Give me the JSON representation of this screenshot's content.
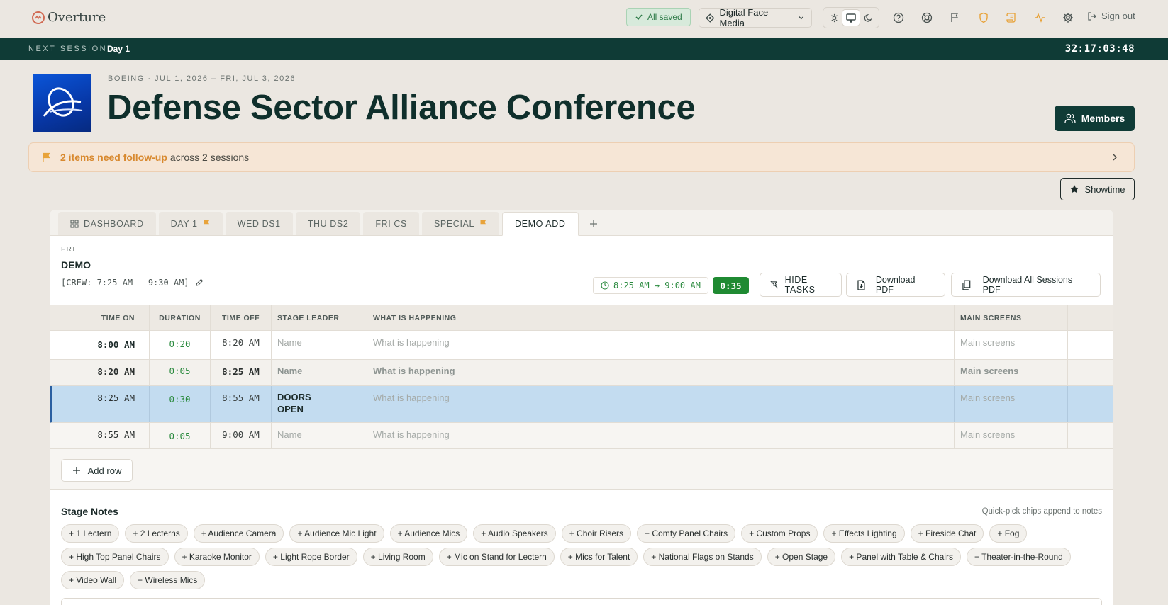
{
  "app": {
    "brand": "Overture",
    "save_status": "All saved",
    "org": "Digital Face Media",
    "sign_out": "Sign out"
  },
  "next_session": {
    "label": "NEXT SESSION",
    "value": "Day 1",
    "countdown": "32:17:03:48"
  },
  "event": {
    "meta": "BOEING  · JUL 1, 2026 – FRI, JUL 3, 2026",
    "title": "Defense Sector Alliance Conference",
    "members_label": "Members"
  },
  "followup": {
    "highlight": "2 items need follow-up",
    "rest": "across 2 sessions"
  },
  "showtime_label": "Showtime",
  "tabs": [
    {
      "label": "DASHBOARD",
      "icon": "grid-icon"
    },
    {
      "label": "DAY 1",
      "flag": true
    },
    {
      "label": "WED DS1"
    },
    {
      "label": "THU DS2"
    },
    {
      "label": "FRI CS"
    },
    {
      "label": "SPECIAL",
      "flag": true
    },
    {
      "label": "DEMO ADD",
      "active": true
    }
  ],
  "session": {
    "day": "FRI",
    "name": "DEMO",
    "crew": "[CREW: 7:25 AM – 9:30 AM]",
    "time_range": "8:25 AM → 9:00 AM",
    "duration": "0:35",
    "hide_tasks": "HIDE TASKS",
    "download_pdf": "Download PDF",
    "download_all": "Download All Sessions PDF"
  },
  "table": {
    "headers": [
      "TIME ON",
      "DURATION",
      "TIME OFF",
      "STAGE LEADER",
      "WHAT IS HAPPENING",
      "MAIN SCREENS"
    ],
    "rows": [
      {
        "time_on": "8:00 AM",
        "duration": "0:20",
        "time_off": "8:20 AM",
        "leader": "Name",
        "happening": "What is happening",
        "screens": "Main screens"
      },
      {
        "time_on": "8:20 AM",
        "duration": "0:05",
        "time_off": "8:25 AM",
        "leader": "Name",
        "happening": "What is happening",
        "screens": "Main screens"
      },
      {
        "time_on": "8:25 AM",
        "duration": "0:30",
        "time_off": "8:55 AM",
        "leader": "DOORS OPEN",
        "happening": "What is happening",
        "screens": "Main screens"
      },
      {
        "time_on": "8:55 AM",
        "duration": "0:05",
        "time_off": "9:00 AM",
        "leader": "Name",
        "happening": "What is happening",
        "screens": "Main screens"
      }
    ],
    "add_row": "Add row"
  },
  "stage_notes": {
    "title": "Stage Notes",
    "hint": "Quick-pick chips append to notes",
    "chips": [
      "+ 1 Lectern",
      "+ 2 Lecterns",
      "+ Audience Camera",
      "+ Audience Mic Light",
      "+ Audience Mics",
      "+ Audio Speakers",
      "+ Choir Risers",
      "+ Comfy Panel Chairs",
      "+ Custom Props",
      "+ Effects Lighting",
      "+ Fireside Chat",
      "+ Fog",
      "+ High Top Panel Chairs",
      "+ Karaoke Monitor",
      "+ Light Rope Border",
      "+ Living Room",
      "+ Mic on Stand for Lectern",
      "+ Mics for Talent",
      "+ National Flags on Stands",
      "+ Open Stage",
      "+ Panel with Table & Chairs",
      "+ Theater-in-the-Round",
      "+ Video Wall",
      "+ Wireless Mics"
    ]
  },
  "colors": {
    "accent_dark": "#0f3b36",
    "flag_orange": "#e8a33a",
    "green": "#2a8a3e",
    "selected_row": "#c3dcf0"
  }
}
